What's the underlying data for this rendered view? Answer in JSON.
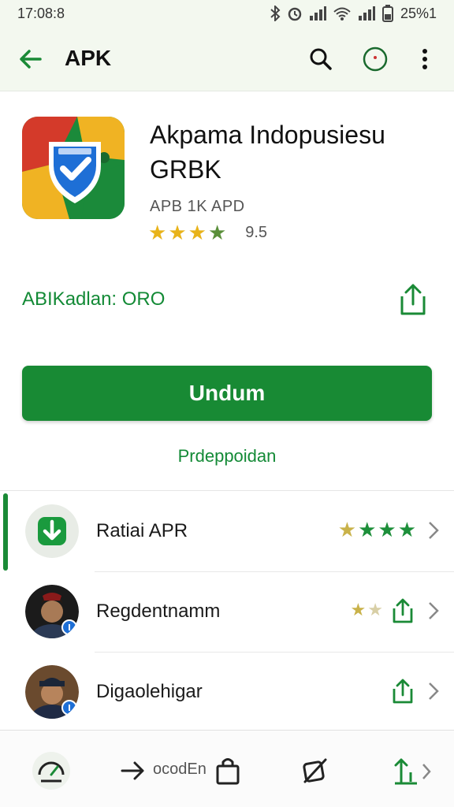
{
  "status_bar": {
    "time": "17:08:8",
    "battery": "25%1"
  },
  "app_bar": {
    "title": "APK"
  },
  "app": {
    "name": "Akpama Indopusiesu",
    "subtitle": "GRBK",
    "meta": "APB 1K APD",
    "rating_stars": 3.5,
    "rating_text": "9.5"
  },
  "developer": {
    "label": "ABIKadlan: ORO"
  },
  "actions": {
    "install_label": "Undum",
    "secondary_label": "Prdeppoidan"
  },
  "list": [
    {
      "label": "Ratiai APR",
      "stars_filled": 4
    },
    {
      "label": "Regdentnamm",
      "stars_filled": 2
    },
    {
      "label": "Digaolehigar"
    }
  ],
  "bottom_nav": {
    "label": "ocodEn"
  },
  "colors": {
    "brand_green": "#188a34",
    "star_gold": "#d4b44a",
    "star_green": "#1d8f3a",
    "app_bar_bg": "#f3f8ef"
  }
}
